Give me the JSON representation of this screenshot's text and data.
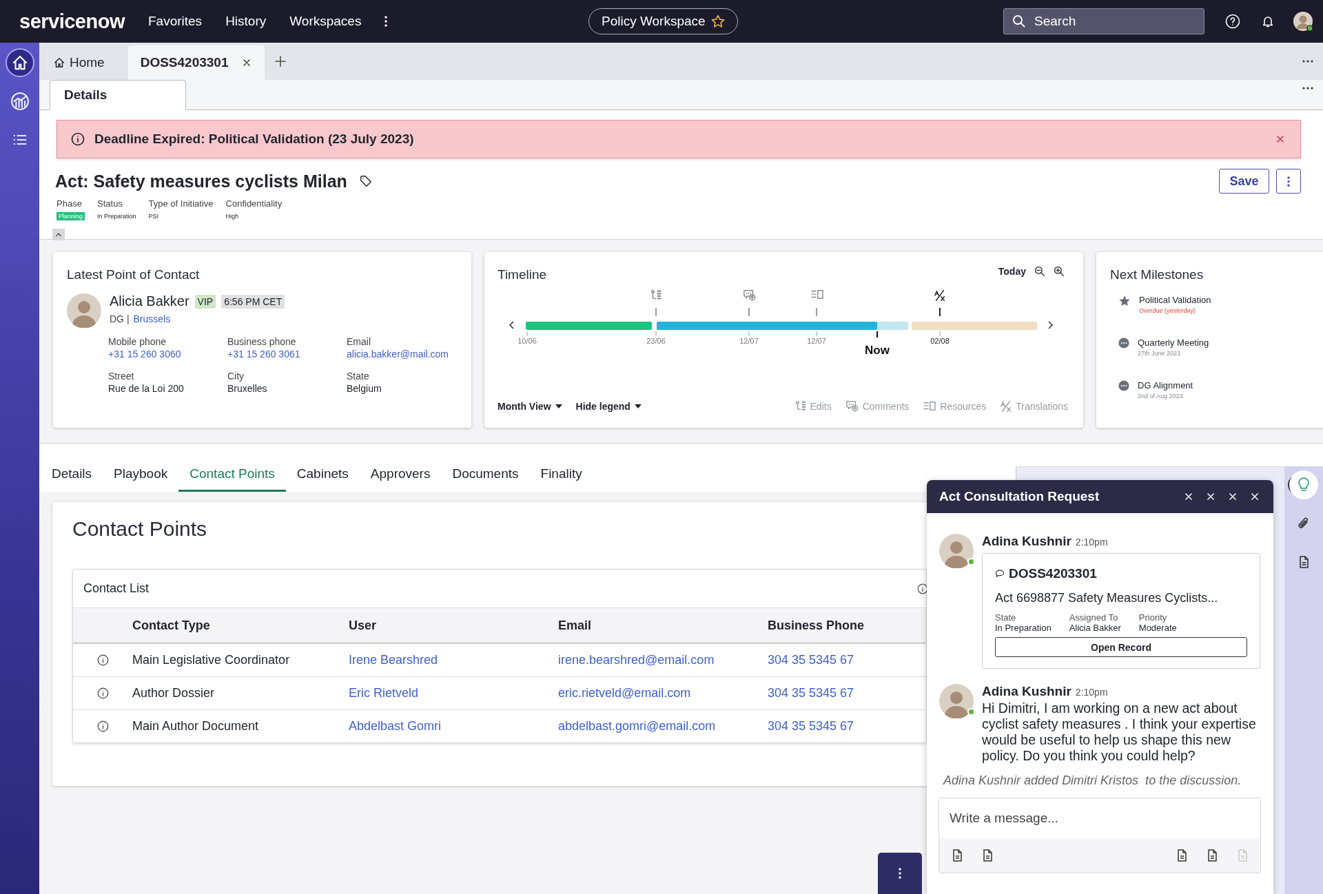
{
  "top_bar": {
    "logo": "servicenow",
    "nav": [
      "Favorites",
      "History",
      "Workspaces"
    ],
    "workspace": "Policy Workspace",
    "search": {
      "placeholder": "Search"
    }
  },
  "left_rail": [
    {
      "kind": "home",
      "selected": true
    },
    {
      "kind": "analytics",
      "selected": false
    },
    {
      "kind": "list",
      "selected": false
    }
  ],
  "tabs": [
    {
      "label": "Home",
      "kind": "home",
      "selected": false
    },
    {
      "label": "DOSS4203301",
      "kind": "record",
      "selected": true
    }
  ],
  "sub_tabs": [
    {
      "label": "Details",
      "selected": true
    }
  ],
  "alert": {
    "message": "Deadline Expired: Political Validation (23 July 2023)"
  },
  "record": {
    "title": "Act: Safety measures cyclists Milan",
    "save_button": "Save",
    "fields": [
      {
        "label": "Phase",
        "value": "Planning",
        "kind": "badge"
      },
      {
        "label": "Status",
        "value": "In Preparation",
        "kind": "text"
      },
      {
        "label": "Type of Initiative",
        "value": "PSI",
        "kind": "text"
      },
      {
        "label": "Confidentiality",
        "value": "High",
        "kind": "text"
      }
    ]
  },
  "contact_card": {
    "title": "Latest Point of Contact",
    "name": "Alicia Bakker",
    "badges": [
      {
        "text": "VIP",
        "color": "#cfe8c6"
      },
      {
        "text": "6:56 PM CET",
        "color": "#e1e1e4"
      }
    ],
    "org": "DG |",
    "location": "Brussels",
    "details": [
      {
        "label": "Mobile phone",
        "value": "+31 15 260 3060",
        "link": true
      },
      {
        "label": "Business phone",
        "value": "+31 15 260 3061",
        "link": true
      },
      {
        "label": "Email",
        "value": "alicia.bakker@mail.com",
        "link": true
      },
      {
        "label": "Street",
        "value": "Rue de la Loi 200",
        "link": false
      },
      {
        "label": "City",
        "value": "Bruxelles",
        "link": false
      },
      {
        "label": "State",
        "value": "Belgium",
        "link": false
      }
    ]
  },
  "timeline": {
    "title": "Timeline",
    "today": "Today",
    "ticks": [
      {
        "label": "10/06",
        "kind": "date"
      },
      {
        "label": "23/06",
        "kind": "date",
        "marker": {
          "kind": "edit"
        }
      },
      {
        "label": "12/07",
        "kind": "date",
        "marker": {
          "kind": "comment"
        }
      },
      {
        "label": "12/07",
        "kind": "date",
        "marker": {
          "kind": "resource"
        }
      },
      {
        "label": "Now",
        "kind": "now"
      },
      {
        "label": "02/08",
        "kind": "date",
        "marker": {
          "kind": "translation"
        }
      }
    ],
    "segments": [
      {
        "color": "#1fc47e"
      },
      {
        "color": "#25b4d8"
      },
      {
        "color": "#c3e7f1"
      },
      {
        "color": "#f0dfc2"
      }
    ],
    "view": "Month View",
    "legend_toggle": "Hide legend",
    "legend": [
      {
        "label": "Edits",
        "kind": "edit"
      },
      {
        "label": "Comments",
        "kind": "comment"
      },
      {
        "label": "Resources",
        "kind": "resource"
      },
      {
        "label": "Translations",
        "kind": "translation"
      }
    ]
  },
  "milestones": {
    "title": "Next Milestones",
    "items": [
      {
        "kind": "star",
        "name": "Political Validation",
        "date": "Overdue (yesterday)",
        "overdue": true
      },
      {
        "kind": "meeting",
        "name": "Quarterly Meeting",
        "date": "27th June 2023",
        "overdue": false
      },
      {
        "kind": "meeting",
        "name": "DG Alignment",
        "date": "2nd of Aug 2023",
        "overdue": false
      }
    ]
  },
  "section_tabs": [
    {
      "label": "Details",
      "selected": false
    },
    {
      "label": "Playbook",
      "selected": false
    },
    {
      "label": "Contact Points",
      "selected": true
    },
    {
      "label": "Cabinets",
      "selected": false
    },
    {
      "label": "Approvers",
      "selected": false
    },
    {
      "label": "Documents",
      "selected": false
    },
    {
      "label": "Finality",
      "selected": false
    }
  ],
  "contact_points": {
    "title": "Contact Points",
    "list_title": "Contact List",
    "columns": [
      "Contact Type",
      "User",
      "Email",
      "Business Phone"
    ],
    "rows": [
      {
        "contact_type": "Main Legislative Coordinator",
        "user": "Irene Bearshred",
        "email": "irene.bearshred@email.com",
        "business_phone": "304 35 5345 67"
      },
      {
        "contact_type": "Author Dossier",
        "user": "Eric Rietveld",
        "email": "eric.rietveld@email.com",
        "business_phone": "304 35 5345 67"
      },
      {
        "contact_type": "Main Author Document",
        "user": "Abdelbast Gomri",
        "email": "abdelbast.gomri@email.com",
        "business_phone": "304 35 5345 67"
      }
    ]
  },
  "chat": {
    "title": "Act Consultation Request",
    "messages": [
      {
        "kind": "record",
        "author": "Adina Kushnir",
        "time": "2:10pm",
        "online": true,
        "record": {
          "number": "DOSS4203301",
          "title": "Act 6698877 Safety Measures Cyclists...",
          "fields": [
            {
              "label": "State",
              "value": "In Preparation"
            },
            {
              "label": "Assigned To",
              "value": "Alicia Bakker"
            },
            {
              "label": "Priority",
              "value": "Moderate"
            }
          ],
          "button": "Open Record"
        }
      },
      {
        "kind": "text",
        "author": "Adina Kushnir",
        "time": "2:10pm",
        "online": true,
        "text": "Hi Dimitri, I am working on a new act about cyclist safety measures . I think your expertise would be useful to help us shape this new policy. Do you think you could help?"
      }
    ],
    "note": "Adina Kushnir added Dimitri Kristos  to the discussion.",
    "composer": {
      "placeholder": "Write a message...",
      "tools": [
        {
          "disabled": false
        },
        {
          "disabled": false
        },
        {
          "disabled": false
        },
        {
          "disabled": false
        },
        {
          "disabled": true
        }
      ]
    }
  },
  "side_rail": [
    {
      "kind": "idea",
      "selected": true
    },
    {
      "kind": "attachment",
      "selected": false
    },
    {
      "kind": "document",
      "selected": false
    }
  ]
}
